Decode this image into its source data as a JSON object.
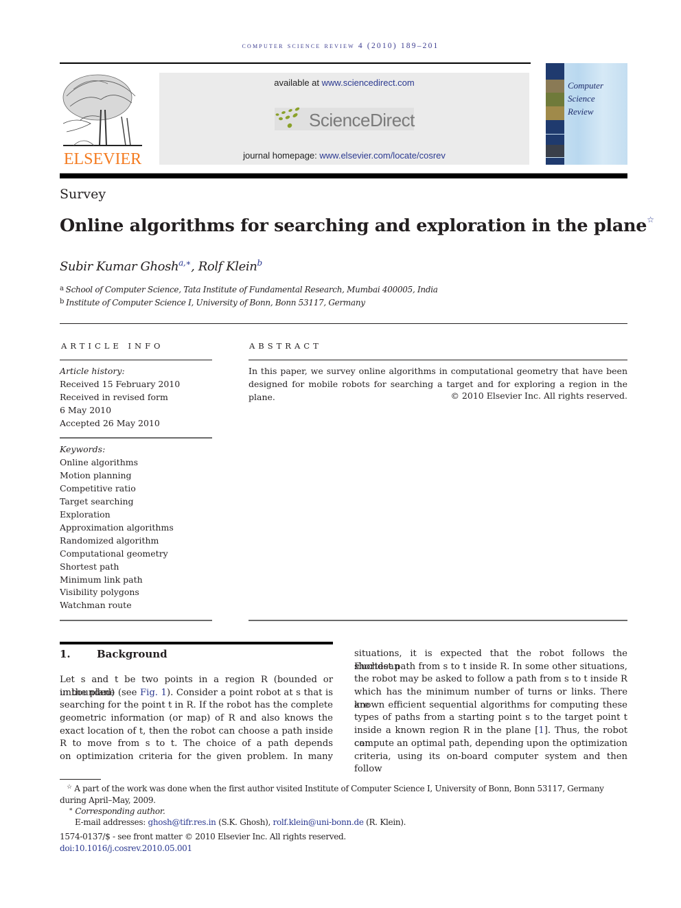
{
  "journal": {
    "running_head": "computer science review 4 (2010) 189–201",
    "publisher_logo_text": "ELSEVIER",
    "available_prefix": "available at ",
    "available_link": "www.sciencedirect.com",
    "sciencedirect_logo_text": "ScienceDirect",
    "homepage_prefix": "journal homepage: ",
    "homepage_link": "www.elsevier.com/locate/cosrev",
    "cover_title": [
      "Computer",
      "Science",
      "Review"
    ]
  },
  "article": {
    "section_type": "Survey",
    "title": "Online algorithms for searching and exploration in the plane",
    "title_note_mark": "☆",
    "authors": [
      {
        "name": "Subir Kumar Ghosh",
        "marks": "a,∗"
      },
      {
        "name": "Rolf Klein",
        "marks": "b"
      }
    ],
    "author_separator": ", ",
    "affiliations": [
      {
        "mark": "a",
        "text": "School of Computer Science, Tata Institute of Fundamental Research, Mumbai 400005, India"
      },
      {
        "mark": "b",
        "text": "Institute of Computer Science I, University of Bonn, Bonn 53117, Germany"
      }
    ]
  },
  "article_info": {
    "heading": "ARTICLE INFO",
    "history_label": "Article history:",
    "history": [
      "Received 15 February 2010",
      "Received in revised form",
      "6 May 2010",
      "Accepted 26 May 2010"
    ],
    "keywords_label": "Keywords:",
    "keywords": [
      "Online algorithms",
      "Motion planning",
      "Competitive ratio",
      "Target searching",
      "Exploration",
      "Approximation algorithms",
      "Randomized algorithm",
      "Computational geometry",
      "Shortest path",
      "Minimum link path",
      "Visibility polygons",
      "Watchman route"
    ]
  },
  "abstract": {
    "heading": "ABSTRACT",
    "text": "In this paper, we survey online algorithms in computational geometry that have been designed for mobile robots for searching a target and for exploring a region in the plane.",
    "copyright": "© 2010 Elsevier Inc. All rights reserved."
  },
  "section1": {
    "number": "1.",
    "title": "Background",
    "left_lines": [
      "Let s and t be two points in a region R (bounded or unbounded)",
      "in the plane (see |Fig. 1|). Consider a point robot at s that is",
      "searching for the point t in R. If the robot has the complete",
      "geometric information (or map) of R and also knows the",
      "exact location of t, then the robot can choose a path inside",
      "R to move from s to t. The choice of a path depends",
      "on optimization criteria for the given problem. In many"
    ],
    "right_lines": [
      "situations, it is expected that the robot follows the Euclidean",
      "shortest path from s to t inside R. In some other situations,",
      "the robot may be asked to follow a path from s to t inside R",
      "which has the minimum number of turns or links.  There are",
      "known efficient sequential algorithms for computing these",
      "types of paths from a starting point s to the target point t",
      "inside a known region R in the plane [|1|]. Thus, the robot can",
      "compute an optimal path, depending upon the optimization",
      "criteria, using its on-board computer system and then follow"
    ]
  },
  "footnotes": {
    "star_mark": "☆",
    "star_text_1": " A part of the work was done when the first author visited Institute of Computer Science I, University of Bonn, Bonn 53117, Germany",
    "star_text_2": "during April–May, 2009.",
    "corr_mark": "∗",
    "corr_text": "Corresponding author.",
    "email_label": "E-mail addresses: ",
    "email_1": "ghosh@tifr.res.in",
    "email_1_owner": " (S.K. Ghosh), ",
    "email_2": "rolf.klein@uni-bonn.de",
    "email_2_owner": " (R. Klein).",
    "issn_line": "1574-0137/$ - see front matter © 2010 Elsevier Inc. All rights reserved.",
    "doi": "doi:10.1016/j.cosrev.2010.05.001"
  }
}
